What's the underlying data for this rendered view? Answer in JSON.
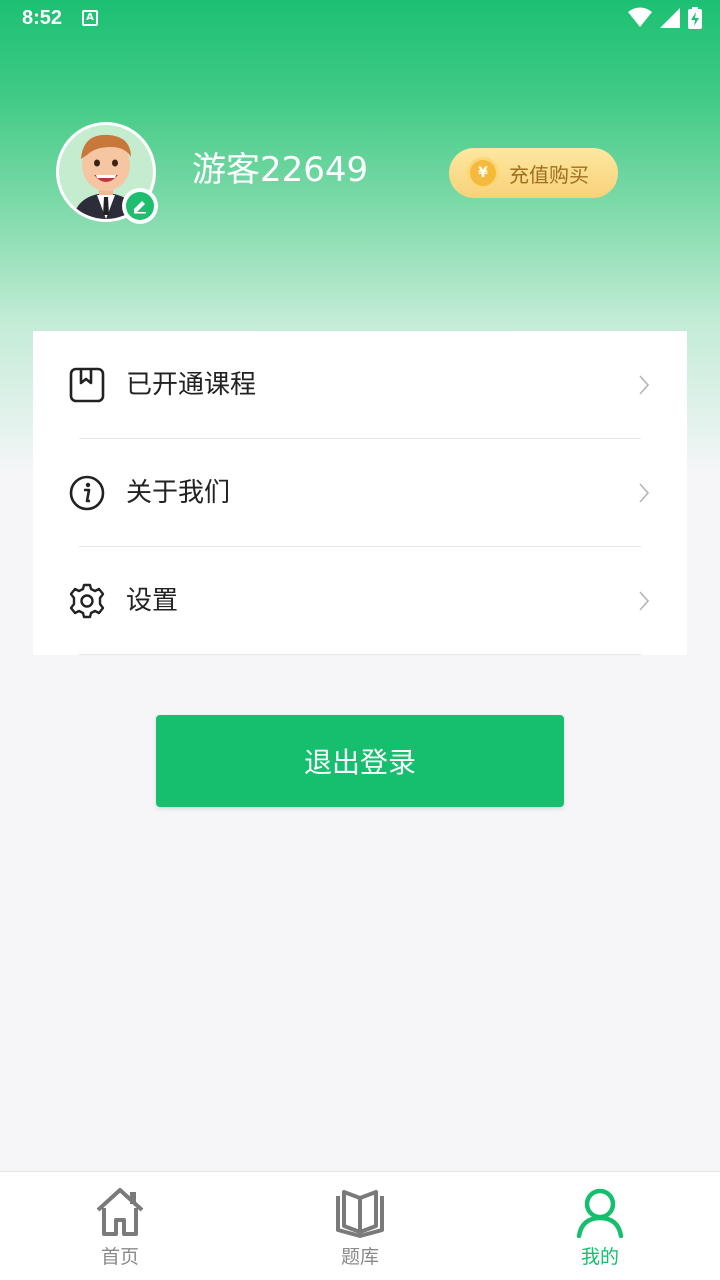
{
  "status_bar": {
    "time": "8:52",
    "notification_icon": "A"
  },
  "profile": {
    "username": "游客22649",
    "recharge_label": "充值购买",
    "coin_symbol": "¥"
  },
  "menu": {
    "items": [
      {
        "label": "已开通课程",
        "icon": "bookmark-icon"
      },
      {
        "label": "关于我们",
        "icon": "info-icon"
      },
      {
        "label": "设置",
        "icon": "gear-icon"
      }
    ]
  },
  "logout_label": "退出登录",
  "tabbar": {
    "tabs": [
      {
        "label": "首页",
        "icon": "home-icon",
        "active": false
      },
      {
        "label": "题库",
        "icon": "book-icon",
        "active": false
      },
      {
        "label": "我的",
        "icon": "user-icon",
        "active": true
      }
    ]
  },
  "colors": {
    "accent": "#15bf6d",
    "gold": "#f8d27a"
  }
}
